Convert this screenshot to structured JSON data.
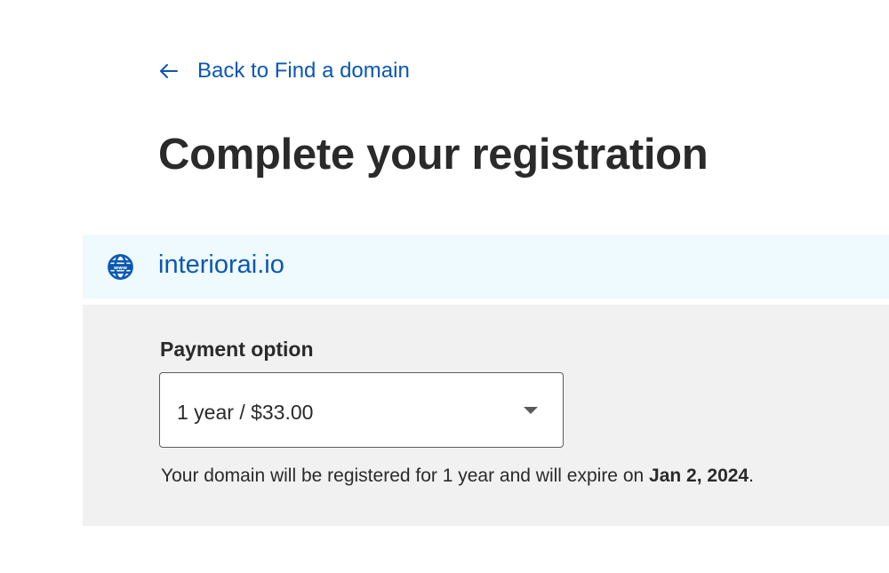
{
  "nav": {
    "back_label": "Back to Find a domain",
    "back_icon": "arrow-left-icon"
  },
  "page": {
    "title": "Complete your registration"
  },
  "domain": {
    "icon": "globe-www-icon",
    "name": "interiorai.io"
  },
  "payment": {
    "label": "Payment option",
    "selected_option": "1 year / $33.00",
    "expiry_prefix": "Your domain will be registered for 1 year and will expire on ",
    "expiry_date": "Jan 2, 2024",
    "expiry_suffix": "."
  },
  "colors": {
    "link": "#0b57b3",
    "domain_bar_bg": "#eefafd",
    "panel_bg": "#f1f1f1",
    "text": "#2a2a2a"
  }
}
